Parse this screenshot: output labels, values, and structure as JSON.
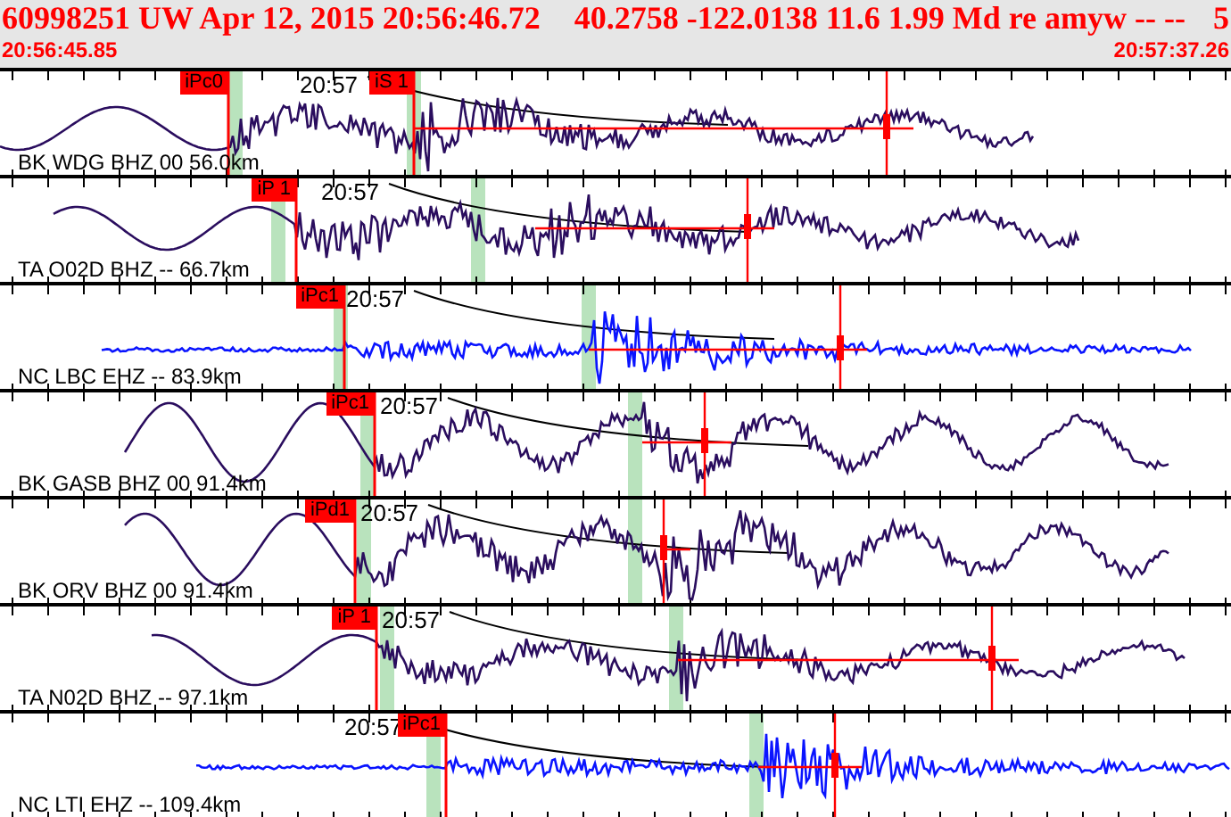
{
  "header": {
    "event_line": "60998251 UW Apr 12, 2015 20:56:46.72",
    "location_line": "40.2758 -122.0138 11.6 1.99 Md re amyw -- --",
    "edge_text": "5",
    "start_time": "20:56:45.85",
    "end_time": "20:57:37.26"
  },
  "traces": [
    {
      "label": "BK WDG BHZ 00 56.0km",
      "kind": "broadband",
      "time_mark": "20:57",
      "picks": [
        {
          "label": "iPc0"
        },
        {
          "label": "iS 1"
        }
      ]
    },
    {
      "label": "TA O02D BHZ -- 66.7km",
      "kind": "broadband",
      "time_mark": "20:57",
      "picks": [
        {
          "label": "iP 1"
        }
      ]
    },
    {
      "label": "NC LBC EHZ -- 83.9km",
      "kind": "short_period",
      "time_mark": "20:57",
      "picks": [
        {
          "label": "iPc1"
        }
      ]
    },
    {
      "label": "BK GASB BHZ 00 91.4km",
      "kind": "broadband",
      "time_mark": "20:57",
      "picks": [
        {
          "label": "iPc1"
        }
      ]
    },
    {
      "label": "BK ORV BHZ 00 91.4km",
      "kind": "broadband",
      "time_mark": "20:57",
      "picks": [
        {
          "label": "iPd1"
        }
      ]
    },
    {
      "label": "TA N02D BHZ -- 97.1km",
      "kind": "broadband",
      "time_mark": "20:57",
      "picks": [
        {
          "label": "iP 1"
        }
      ]
    },
    {
      "label": "NC LTI EHZ -- 109.4km",
      "kind": "short_period",
      "time_mark": "20:57",
      "picks": [
        {
          "label": "iPc1"
        }
      ]
    }
  ]
}
